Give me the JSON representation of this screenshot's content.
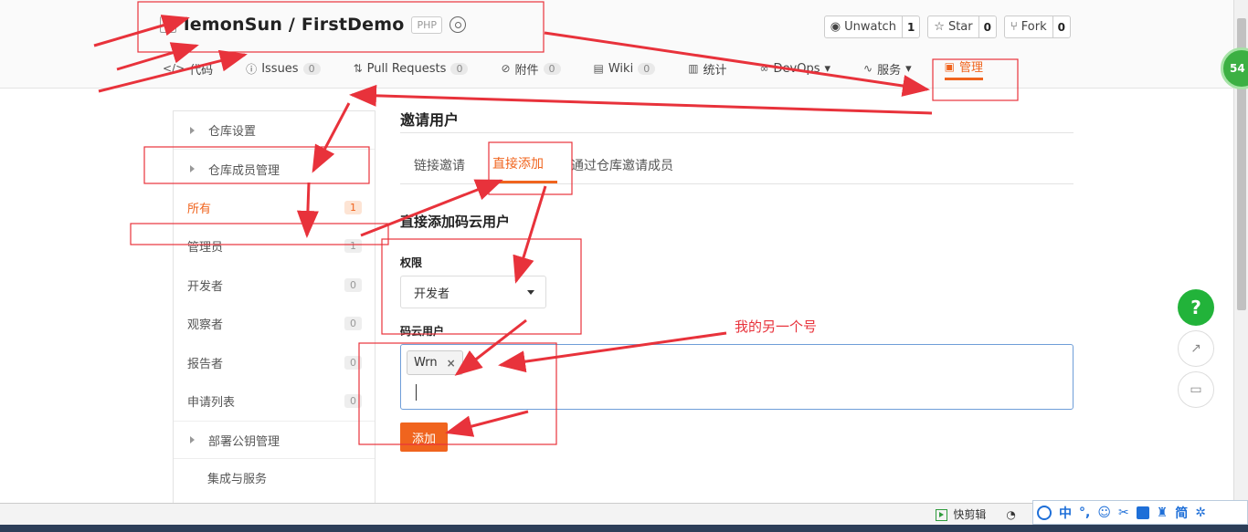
{
  "repo": {
    "owner_and_name": "lemonSun / FirstDemo",
    "lang": "PHP",
    "actions": [
      {
        "label": "Unwatch",
        "count": "1"
      },
      {
        "label": "Star",
        "count": "0"
      },
      {
        "label": "Fork",
        "count": "0"
      }
    ]
  },
  "nav": {
    "code": "代码",
    "issues": "Issues",
    "issues_count": "0",
    "pulls": "Pull Requests",
    "pulls_count": "0",
    "attachments": "附件",
    "attachments_count": "0",
    "wiki": "Wiki",
    "wiki_count": "0",
    "stats": "统计",
    "devops": "DevOps",
    "services": "服务",
    "manage": "管理"
  },
  "sidebar": {
    "repo_settings": "仓库设置",
    "member_mgmt": "仓库成员管理",
    "items": [
      {
        "label": "所有",
        "count": "1"
      },
      {
        "label": "管理员",
        "count": "1"
      },
      {
        "label": "开发者",
        "count": "0"
      },
      {
        "label": "观察者",
        "count": "0"
      },
      {
        "label": "报告者",
        "count": "0"
      },
      {
        "label": "申请列表",
        "count": "0"
      }
    ],
    "deploy_keys": "部署公钥管理",
    "integrations": "集成与服务"
  },
  "main": {
    "heading": "邀请用户",
    "tabs": [
      "链接邀请",
      "直接添加",
      "通过仓库邀请成员"
    ],
    "section_title": "直接添加码云用户",
    "permission_label": "权限",
    "permission_value": "开发者",
    "user_label": "码云用户",
    "chip": "Wrn",
    "add_button": "添加"
  },
  "annotation": {
    "note": "我的另一个号",
    "color": "#e8323b"
  },
  "float": {
    "badge": "54",
    "help": "?"
  },
  "statusbar": {
    "clip": "快剪辑"
  },
  "ime": {
    "zh": "中",
    "simp": "简"
  },
  "colors": {
    "accent": "#f0641e",
    "help_green": "#22b33a",
    "input_border": "#6f9ed8"
  }
}
